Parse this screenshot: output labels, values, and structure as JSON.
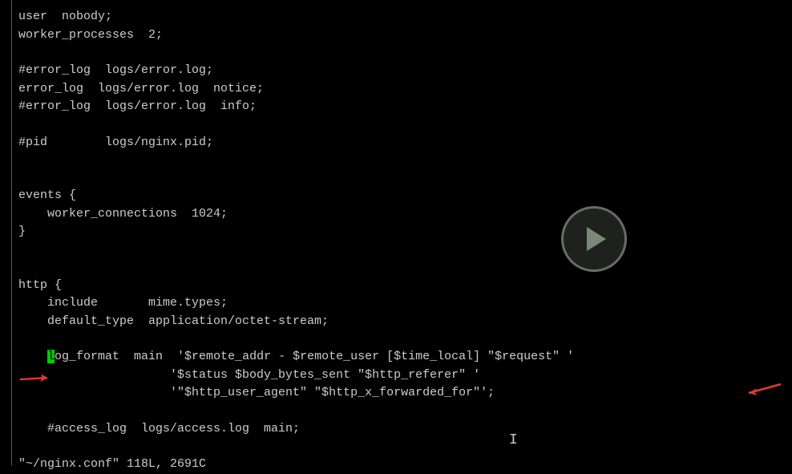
{
  "lines": [
    "user  nobody;",
    "worker_processes  2;",
    "",
    "#error_log  logs/error.log;",
    "error_log  logs/error.log  notice;",
    "#error_log  logs/error.log  info;",
    "",
    "#pid        logs/nginx.pid;",
    "",
    "",
    "events {",
    "    worker_connections  1024;",
    "}",
    "",
    "",
    "http {",
    "    include       mime.types;",
    "    default_type  application/octet-stream;",
    ""
  ],
  "cursor_line": {
    "prefix": "    ",
    "highlighted": "l",
    "suffix": "og_format  main  '$remote_addr - $remote_user [$time_local] \"$request\" '"
  },
  "lines_after": [
    "                     '$status $body_bytes_sent \"$http_referer\" '",
    "                     '\"$http_user_agent\" \"$http_x_forwarded_for\"';",
    "",
    "    #access_log  logs/access.log  main;",
    ""
  ],
  "status_line": "\"~/nginx.conf\" 118L, 2691C",
  "arrows": {
    "left_color": "#e53935",
    "right_color": "#e53935"
  }
}
